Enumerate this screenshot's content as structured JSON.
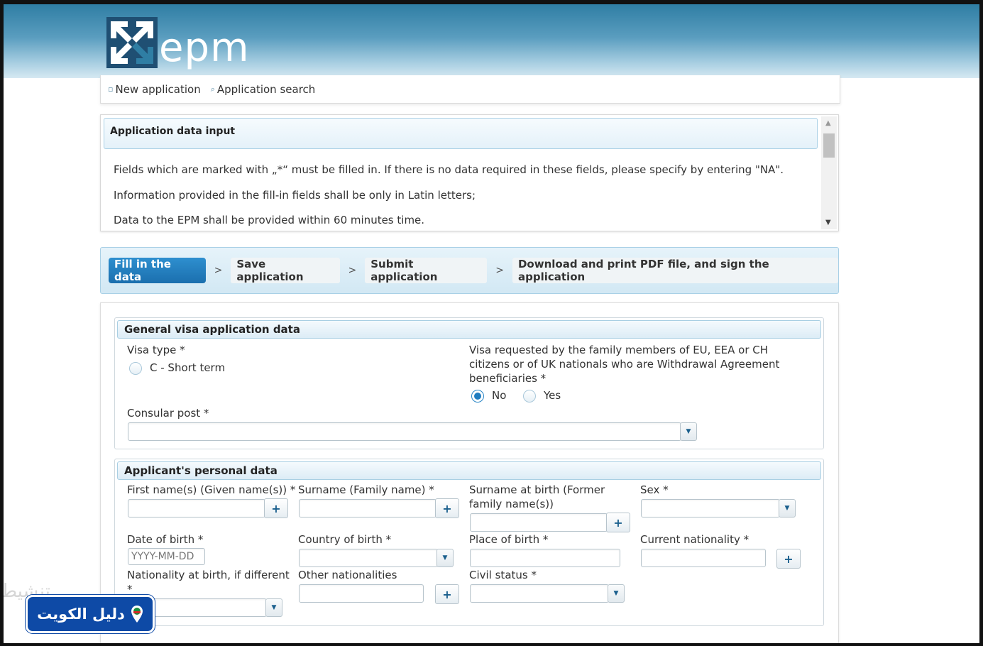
{
  "app": {
    "logo_text": "epm"
  },
  "topnav": {
    "new_application": "New application",
    "application_search": "Application search"
  },
  "info": {
    "title": "Application data input",
    "lines": [
      "Fields which are marked with „*“ must be filled in. If there is no data required in these fields, please specify by entering \"NA\".",
      "Information provided in the fill-in fields shall be only in Latin letters;",
      "Data to the EPM shall be provided within 60 minutes time."
    ]
  },
  "steps": [
    {
      "label": "Fill in the data",
      "active": true
    },
    {
      "label": "Save application",
      "active": false
    },
    {
      "label": "Submit application",
      "active": false
    },
    {
      "label": "Download and print PDF file, and sign the application",
      "active": false
    }
  ],
  "step_separator": ">",
  "general": {
    "title": "General visa application data",
    "visa_type_label": "Visa type *",
    "visa_type_option": "C - Short term",
    "family_label": "Visa requested by the family members of EU, EEA or CH citizens or of UK nationals who are Withdrawal Agreement beneficiaries *",
    "family_no": "No",
    "family_yes": "Yes",
    "family_selected": "No",
    "consular_post_label": "Consular post *"
  },
  "personal": {
    "title": "Applicant's personal data",
    "first_name_label": "First name(s) (Given name(s)) *",
    "surname_label": "Surname (Family name) *",
    "surname_birth_label": "Surname at birth (Former family name(s))",
    "sex_label": "Sex *",
    "dob_label": "Date of birth *",
    "dob_placeholder": "YYYY-MM-DD",
    "country_birth_label": "Country of birth *",
    "place_birth_label": "Place of birth *",
    "current_nationality_label": "Current nationality *",
    "nationality_birth_label": "Nationality at birth, if different *",
    "other_nationalities_label": "Other nationalities",
    "civil_status_label": "Civil status *"
  },
  "badge": {
    "text": "دليل الكويت"
  },
  "watermark": {
    "text": "تنشيط"
  },
  "colors": {
    "accent": "#1b6fae",
    "banner": "#2f7ea4",
    "badge": "#0e4aa6"
  },
  "icons": [
    "new-application-icon",
    "search-icon",
    "dropdown-icon",
    "plus-icon",
    "map-pin-icon"
  ]
}
